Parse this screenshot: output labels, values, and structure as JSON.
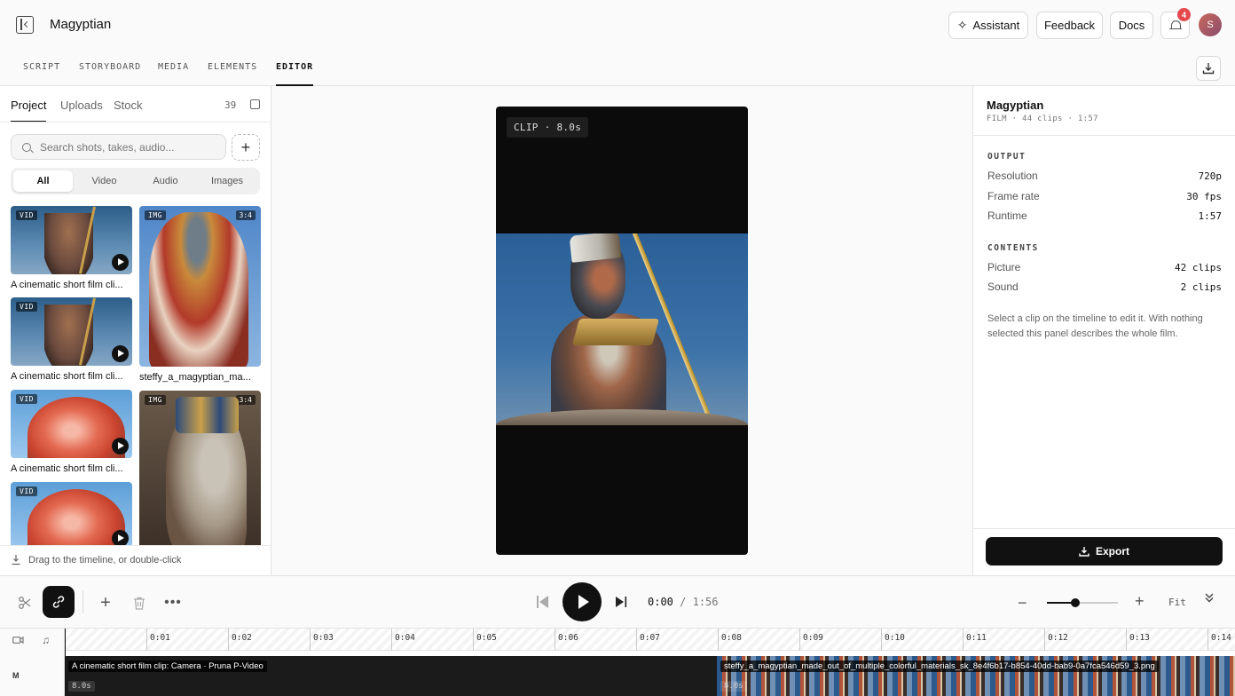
{
  "header": {
    "title": "Magyptian",
    "assistant_label": "Assistant",
    "feedback_label": "Feedback",
    "docs_label": "Docs",
    "notification_count": "4",
    "avatar_initial": "S"
  },
  "nav": {
    "tabs": [
      {
        "label": "SCRIPT"
      },
      {
        "label": "STORYBOARD"
      },
      {
        "label": "MEDIA"
      },
      {
        "label": "ELEMENTS"
      },
      {
        "label": "EDITOR",
        "active": true
      }
    ]
  },
  "library": {
    "tabs": [
      {
        "label": "Project",
        "active": true
      },
      {
        "label": "Uploads"
      },
      {
        "label": "Stock"
      }
    ],
    "count": "39",
    "search_placeholder": "Search shots, takes, audio...",
    "filters": [
      {
        "label": "All",
        "active": true
      },
      {
        "label": "Video"
      },
      {
        "label": "Audio"
      },
      {
        "label": "Images"
      }
    ],
    "items": [
      {
        "kind": "VID",
        "caption": "A cinematic short film cli..."
      },
      {
        "kind": "IMG",
        "ratio": "3:4",
        "caption": "steffy_a_magyptian_ma..."
      },
      {
        "kind": "VID",
        "caption": "A cinematic short film cli..."
      },
      {
        "kind": "VID",
        "caption": "A cinematic short film cli..."
      },
      {
        "kind": "IMG",
        "ratio": "3:4",
        "caption": ""
      },
      {
        "kind": "VID",
        "caption": ""
      }
    ],
    "footer_hint": "Drag to the timeline, or double-click"
  },
  "preview": {
    "clip_label": "CLIP · 8.0s"
  },
  "details": {
    "title": "Magyptian",
    "subtitle": "FILM · 44 clips · 1:57",
    "output_heading": "OUTPUT",
    "output": [
      {
        "key": "Resolution",
        "value": "720p"
      },
      {
        "key": "Frame rate",
        "value": "30 fps"
      },
      {
        "key": "Runtime",
        "value": "1:57"
      }
    ],
    "contents_heading": "CONTENTS",
    "contents": [
      {
        "key": "Picture",
        "value": "42 clips"
      },
      {
        "key": "Sound",
        "value": "2 clips"
      }
    ],
    "help_text": "Select a clip on the timeline to edit it. With nothing selected this panel describes the whole film.",
    "export_label": "Export"
  },
  "transport": {
    "current_time": "0:00",
    "separator": "/",
    "total_time": "1:56",
    "zoom_level": 0.4,
    "fit_label": "Fit"
  },
  "timeline": {
    "track_label": "M",
    "ticks": [
      "0:01",
      "0:02",
      "0:03",
      "0:04",
      "0:05",
      "0:06",
      "0:07",
      "0:08",
      "0:09",
      "0:10",
      "0:11",
      "0:12",
      "0:13",
      "0:14"
    ],
    "clips": [
      {
        "title": "A cinematic short film clip: Camera · Pruna P-Video",
        "duration": "8.0s"
      },
      {
        "title": "steffy_a_magyptian_made_out_of_multiple_colorful_materials_sk_8e4f6b17-b854-40dd-bab9-0a7fca546d59_3.png",
        "duration": "8.0s"
      }
    ]
  },
  "colors": {
    "accent": "#111111",
    "badge": "#e5484d"
  }
}
